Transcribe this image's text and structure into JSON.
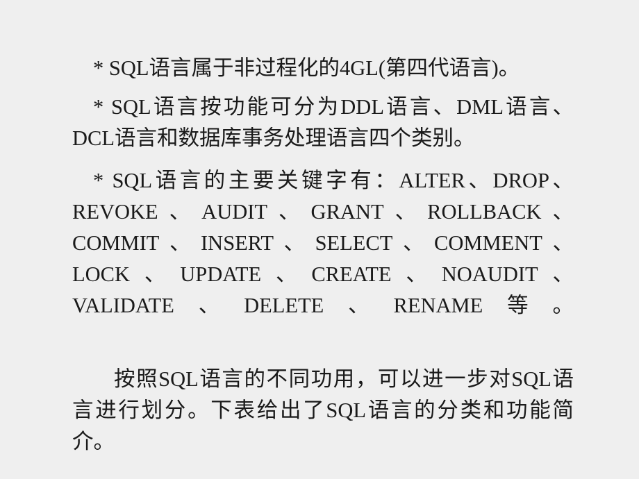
{
  "slide": {
    "background_color": "#efefef",
    "text_color": "#1a1a1a",
    "paragraphs": [
      {
        "id": "p1",
        "bullet": "*",
        "text": "* SQL语言属于非过程化的4GL(第四代语言)。"
      },
      {
        "id": "p2",
        "bullet": "*",
        "text": "* SQL语言按功能可分为DDL语言、DML语言、DCL语言和数据库事务处理语言四个类别。"
      },
      {
        "id": "p3",
        "bullet": "*",
        "text": "* SQL语言的主要关键字有：ALTER、DROP、REVOKE、AUDIT、GRANT、ROLLBACK、COMMIT、INSERT、SELECT、COMMENT、LOCK、UPDATE、CREATE、NOAUDIT、VALIDATE、DELETE、RENAME等。"
      },
      {
        "id": "p4",
        "bullet": "",
        "text": "按照SQL语言的不同功用，可以进一步对SQL语言进行划分。下表给出了SQL语言的分类和功能简介。"
      }
    ],
    "keywords": [
      "ALTER",
      "DROP",
      "REVOKE",
      "AUDIT",
      "GRANT",
      "ROLLBACK",
      "COMMIT",
      "INSERT",
      "SELECT",
      "COMMENT",
      "LOCK",
      "UPDATE",
      "CREATE",
      "NOAUDIT",
      "VALIDATE",
      "DELETE",
      "RENAME"
    ],
    "sql_categories": [
      "DDL语言",
      "DML语言",
      "DCL语言",
      "数据库事务处理语言"
    ]
  }
}
